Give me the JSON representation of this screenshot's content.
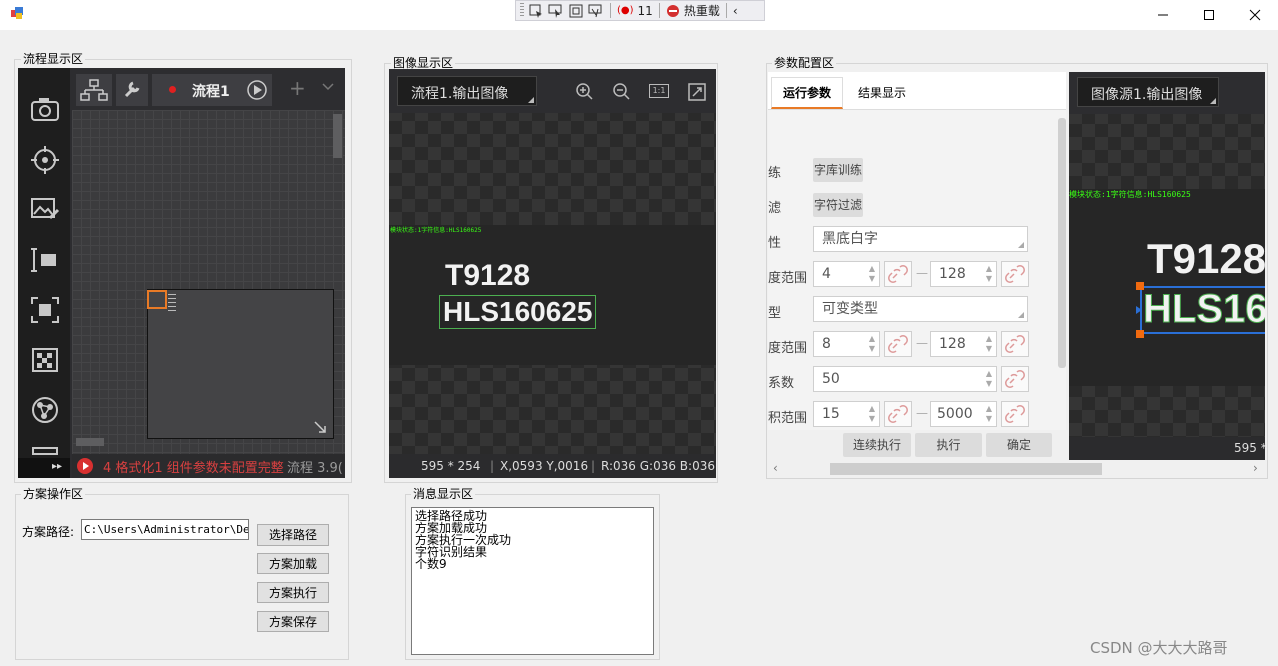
{
  "debug_toolbar": {
    "count": "11",
    "hot_reload": "热重载"
  },
  "flow_panel": {
    "title": "流程显示区",
    "tab_name": "流程1",
    "status": "4 格式化1 组件参数未配置完整",
    "status_right": "流程 3.9("
  },
  "image_panel": {
    "title": "图像显示区",
    "source": "流程1.输出图像",
    "zoom_fit": "1:1",
    "info_size": "595 * 254",
    "info_xy": "X,0593  Y,0016",
    "info_rgb": "R:036  G:036  B:036",
    "overlay_small": "模块状态:1字符信息:HLS160625",
    "text_line1": "T9128",
    "text_line2": "HLS160625"
  },
  "param_panel": {
    "title": "参数配置区",
    "tab_run": "运行参数",
    "tab_result": "结果显示",
    "rows": [
      {
        "label": "练",
        "button": "字库训练"
      },
      {
        "label": "滤",
        "button": "字符过滤"
      },
      {
        "label": "性",
        "select": "黑底白字"
      },
      {
        "label": "度范围",
        "min": "4",
        "max": "128"
      },
      {
        "label": "型",
        "select": "可变类型"
      },
      {
        "label": "度范围",
        "min": "8",
        "max": "128"
      },
      {
        "label": "系数",
        "value": "50"
      },
      {
        "label": "积范围",
        "min": "15",
        "max": "5000"
      }
    ],
    "btn_continuous": "连续执行",
    "btn_execute": "执行",
    "btn_confirm": "确定",
    "preview_source": "图像源1.输出图像",
    "preview_overlay": "模块状态:1字符信息:HLS160625",
    "preview_line1": "T9128",
    "preview_line2": "HLS16",
    "preview_info": "595 *"
  },
  "scheme_panel": {
    "title": "方案操作区",
    "path_label": "方案路径:",
    "path_value": "C:\\Users\\Administrator\\Desk",
    "btn_select": "选择路径",
    "btn_load": "方案加载",
    "btn_run": "方案执行",
    "btn_save": "方案保存"
  },
  "message_panel": {
    "title": "消息显示区",
    "lines": [
      "选择路径成功",
      "方案加载成功",
      "方案执行一次成功",
      "字符识别结果",
      "个数9"
    ]
  },
  "watermark": "CSDN @大大大路哥"
}
